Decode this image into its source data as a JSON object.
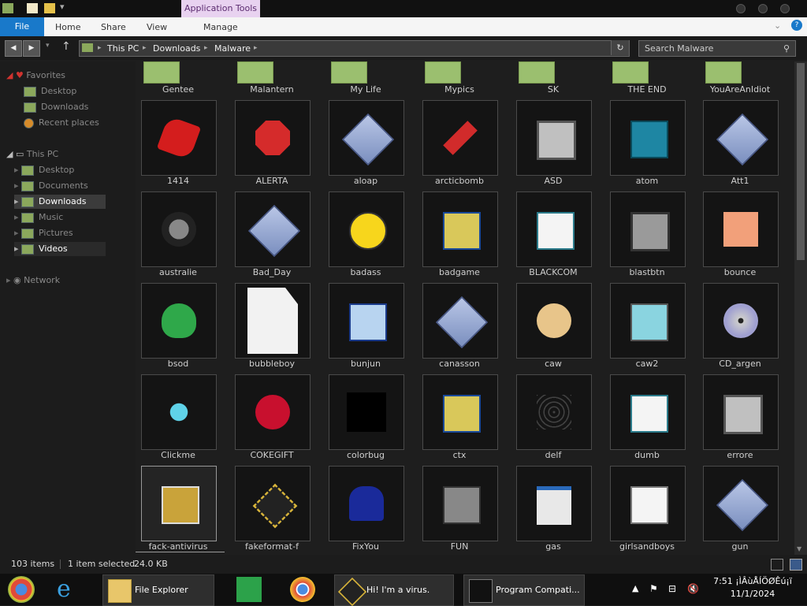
{
  "title_bar": {
    "app_tools_label": "Application Tools"
  },
  "ribbon": {
    "tabs": [
      "File",
      "Home",
      "Share",
      "View",
      "Manage"
    ]
  },
  "address": {
    "breadcrumbs": [
      "This PC",
      "Downloads",
      "Malware"
    ],
    "search_placeholder": "Search Malware"
  },
  "nav": {
    "favorites_label": "Favorites",
    "favorites": [
      "Desktop",
      "Downloads",
      "Recent places"
    ],
    "thispc_label": "This PC",
    "thispc_items": [
      "Desktop",
      "Documents",
      "Downloads",
      "Music",
      "Pictures",
      "Videos"
    ],
    "network_label": "Network"
  },
  "files": {
    "top_row": [
      "Gentee",
      "Malantern",
      "My Life",
      "Mypics",
      "SK",
      "THE END",
      "YouAreAnIdiot"
    ],
    "rows": [
      [
        "1414",
        "ALERTA",
        "aloap",
        "arcticbomb",
        "ASD",
        "atom",
        "Att1"
      ],
      [
        "australie",
        "Bad_Day",
        "badass",
        "badgame",
        "BLACKCOM",
        "blastbtn",
        "bounce"
      ],
      [
        "bsod",
        "bubbleboy",
        "bunjun",
        "canasson",
        "caw",
        "caw2",
        "CD_argen"
      ],
      [
        "Clickme",
        "COKEGIFT",
        "colorbug",
        "ctx",
        "delf",
        "dumb",
        "errore"
      ],
      [
        "fack-antivirus",
        "fakeformat-f",
        "FixYou",
        "FUN",
        "gas",
        "girlsandboys",
        "gun"
      ]
    ],
    "icons": [
      [
        "red-splat-icon",
        "stop-sign-icon",
        "installer-diamond-icon",
        "dynamite-icon",
        "computer-icon",
        "calculator-icon",
        "installer-diamond-icon"
      ],
      [
        "skull-icon",
        "installer-diamond-icon",
        "smiley-icon",
        "program-box-icon",
        "script-icon",
        "monitor-icon",
        "smiley-tile-icon"
      ],
      [
        "frog-icon",
        "document-icon",
        "font-icon",
        "installer-diamond-icon",
        "palette-icon",
        "notepad-icon",
        "cd-icon"
      ],
      [
        "snowflake-icon",
        "coke-icon",
        "black-square-icon",
        "program-box-icon",
        "spider-web-icon",
        "script-icon",
        "computer-icon"
      ],
      [
        "photo-icon",
        "chip-icon",
        "mascot-icon",
        "projector-icon",
        "window-icon",
        "gear-doc-icon",
        "installer-diamond-icon"
      ]
    ],
    "selected": "fack-antivirus"
  },
  "status": {
    "count": "103 items",
    "selected": "1 item selected",
    "size": "24.0 KB"
  },
  "taskbar": {
    "items": [
      "File Explorer",
      "Hi! I'm a virus.",
      "Program Compati..."
    ],
    "time": "7:51 ¡ÌÂùÅÍÖØÊú¡ï",
    "date": "11/1/2024"
  },
  "colors": {
    "accent": "#1979ca",
    "background": "#1e1e1e",
    "app_tools": "#e8d2f0"
  }
}
